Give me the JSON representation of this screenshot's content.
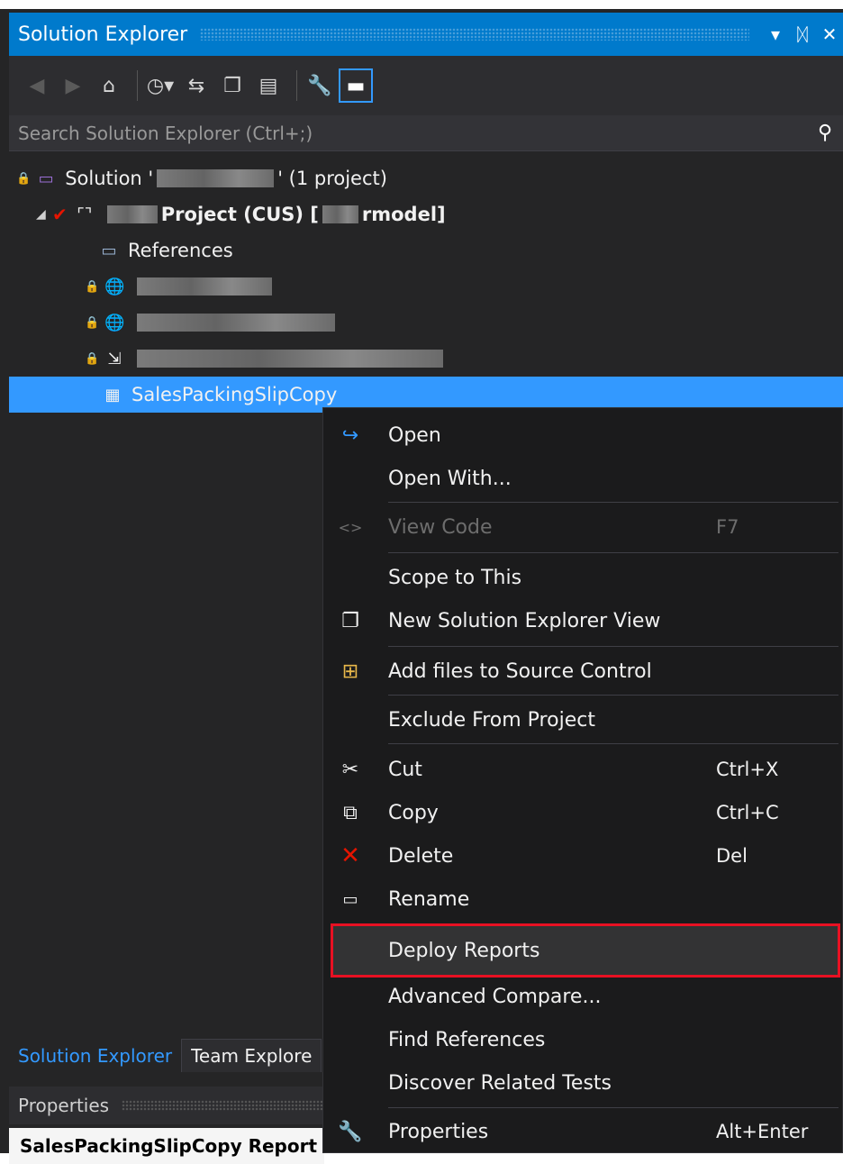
{
  "panel": {
    "title": "Solution Explorer",
    "title_buttons": [
      "▾",
      "ᛞ",
      "✕"
    ]
  },
  "toolbar": {
    "icons": [
      "back-icon",
      "forward-icon",
      "home-icon",
      "pending-changes-icon",
      "sync-icon",
      "collapse-all-icon",
      "show-all-files-icon",
      "properties-icon",
      "preview-icon"
    ]
  },
  "search": {
    "placeholder": "Search Solution Explorer (Ctrl+;)"
  },
  "tree": {
    "solution_prefix": "Solution '",
    "solution_suffix": "' (1 project)",
    "project_label": "Project (CUS) [",
    "project_suffix": "rmodel]",
    "references": "References",
    "selected_item": "SalesPackingSlipCopy"
  },
  "context_menu": {
    "open": "Open",
    "open_with": "Open With...",
    "view_code": "View Code",
    "view_code_shortcut": "F7",
    "scope_to_this": "Scope to This",
    "new_view": "New Solution Explorer View",
    "add_source_control": "Add files to Source Control",
    "exclude": "Exclude From Project",
    "cut": "Cut",
    "cut_shortcut": "Ctrl+X",
    "copy": "Copy",
    "copy_shortcut": "Ctrl+C",
    "delete": "Delete",
    "delete_shortcut": "Del",
    "rename": "Rename",
    "deploy_reports": "Deploy Reports",
    "advanced_compare": "Advanced Compare...",
    "find_references": "Find References",
    "discover_tests": "Discover Related Tests",
    "properties": "Properties",
    "properties_shortcut": "Alt+Enter"
  },
  "bottom_tabs": {
    "solution_explorer": "Solution Explorer",
    "team_explorer": "Team Explore"
  },
  "properties": {
    "title": "Properties",
    "object": "SalesPackingSlipCopy  Report F"
  },
  "colors": {
    "accent": "#007acc",
    "selection": "#3399ff",
    "highlight_border": "#e81123",
    "background": "#252526"
  }
}
